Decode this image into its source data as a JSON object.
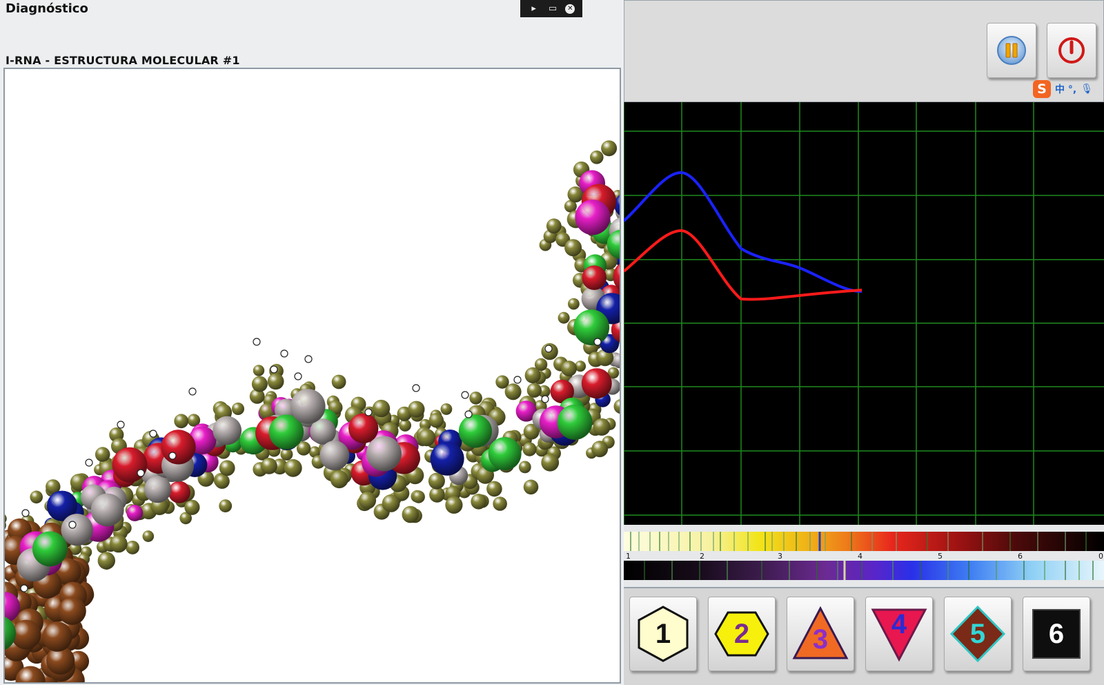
{
  "app": {
    "title": "Diagnóstico",
    "window_controls": [
      "cursor-icon",
      "screen-icon",
      "close-icon"
    ]
  },
  "viewer": {
    "section_title": "I-RNA - ESTRUCTURA MOLECULAR #1",
    "content": "3D RNA molecular model (space-filling spheres)"
  },
  "toolbar": {
    "pause_icon": "pause-icon",
    "power_icon": "power-icon",
    "ime_logo": "S",
    "ime_text": "中 °,",
    "ime_mic": "microphone-icon"
  },
  "graph": {
    "background": "#000000",
    "grid_color": "#1f8a1f",
    "series": [
      {
        "color": "#1a22ff"
      },
      {
        "color": "#ff1a1a"
      }
    ]
  },
  "spectrum": {
    "ticks": [
      "1",
      "2",
      "3",
      "4",
      "5",
      "6",
      "0"
    ]
  },
  "buttons": [
    {
      "label": "1",
      "shape": "hexagon",
      "fill": "#fffccd",
      "text_color": "#111111"
    },
    {
      "label": "2",
      "shape": "hexagon-wide",
      "fill": "#f6f00c",
      "text_color": "#7a2c8e"
    },
    {
      "label": "3",
      "shape": "triangle-up",
      "fill": "#f06a24",
      "text_color": "#8d2ec8"
    },
    {
      "label": "4",
      "shape": "triangle-down",
      "fill": "#e8174f",
      "text_color": "#2b2bd6"
    },
    {
      "label": "5",
      "shape": "diamond",
      "fill": "#7a2a16",
      "text_color": "#33d6d6"
    },
    {
      "label": "6",
      "shape": "square",
      "fill": "#0e0e0e",
      "text_color": "#ffffff"
    }
  ]
}
